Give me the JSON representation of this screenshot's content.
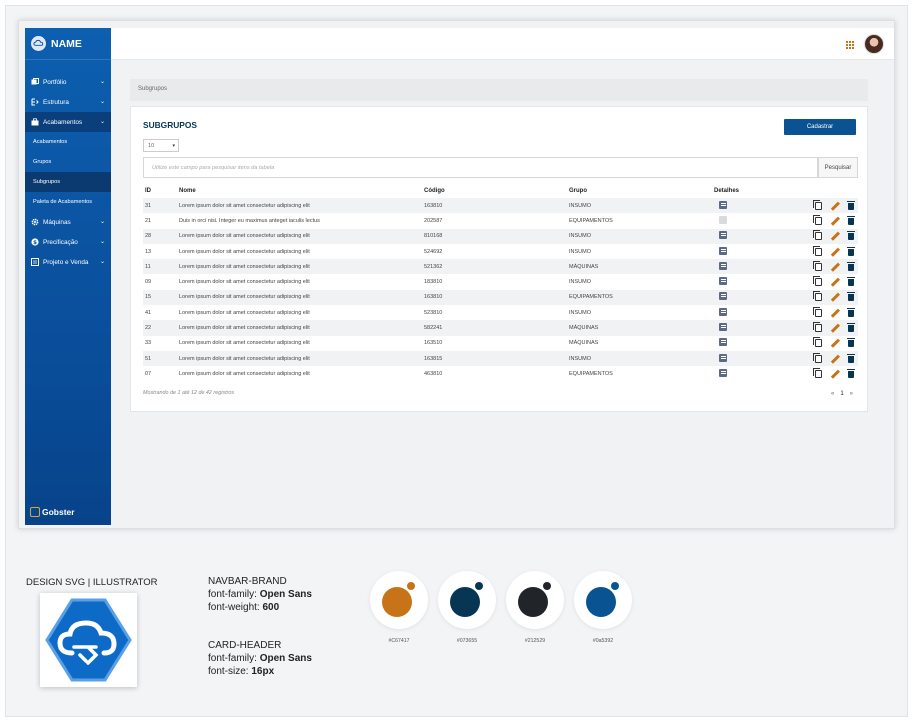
{
  "sidebar": {
    "brand": "NAME",
    "items": [
      {
        "label": "Portfólio",
        "icon": "portfolio-icon"
      },
      {
        "label": "Estrutura",
        "icon": "structure-icon"
      },
      {
        "label": "Acabamentos",
        "icon": "briefcase-icon",
        "active": true
      },
      {
        "label": "Máquinas",
        "icon": "gear-icon"
      },
      {
        "label": "Precificação",
        "icon": "dollar-icon"
      },
      {
        "label": "Projeto e Venda",
        "icon": "project-icon"
      }
    ],
    "subitems": [
      "Acabamentos",
      "Grupos",
      "Subgrupos",
      "Paleta de Acabamentos"
    ],
    "footer_brand": "Gobster"
  },
  "breadcrumb": "Subgrupos",
  "card": {
    "title": "SUBGRUPOS",
    "create_button": "Cadastrar",
    "page_size": "10",
    "search_placeholder": "Utilize este campo para pesquisar itens da tabela",
    "search_button": "Pesquisar",
    "columns": [
      "ID",
      "Nome",
      "Código",
      "Grupo",
      "Detalhes"
    ],
    "rows": [
      {
        "id": "31",
        "nome": "Lorem ipsum dolor sit amet consectetur adipiscing elit",
        "codigo": "163810",
        "grupo": "INSUMO",
        "detalhes": true
      },
      {
        "id": "21",
        "nome": "Duis in orci nisi. Integer eu maximus anteget iaculis lectus",
        "codigo": "202587",
        "grupo": "EQUIPAMENTOS",
        "detalhes": false
      },
      {
        "id": "28",
        "nome": "Lorem ipsum dolor sit amet consectetur adipiscing elit",
        "codigo": "810168",
        "grupo": "INSUMO",
        "detalhes": true
      },
      {
        "id": "13",
        "nome": "Lorem ipsum dolor sit amet consectetur adipiscing elit",
        "codigo": "524692",
        "grupo": "INSUMO",
        "detalhes": true
      },
      {
        "id": "11",
        "nome": "Lorem ipsum dolor sit amet consectetur adipiscing elit",
        "codigo": "521362",
        "grupo": "MÁQUINAS",
        "detalhes": true
      },
      {
        "id": "09",
        "nome": "Lorem ipsum dolor sit amet consectetur adipiscing elit",
        "codigo": "183810",
        "grupo": "INSUMO",
        "detalhes": true
      },
      {
        "id": "15",
        "nome": "Lorem ipsum dolor sit amet consectetur adipiscing elit",
        "codigo": "163810",
        "grupo": "EQUIPAMENTOS",
        "detalhes": true
      },
      {
        "id": "41",
        "nome": "Lorem ipsum dolor sit amet consectetur adipiscing elit",
        "codigo": "523810",
        "grupo": "INSUMO",
        "detalhes": true
      },
      {
        "id": "22",
        "nome": "Lorem ipsum dolor sit amet consectetur adipiscing elit",
        "codigo": "582241",
        "grupo": "MÁQUINAS",
        "detalhes": true
      },
      {
        "id": "33",
        "nome": "Lorem ipsum dolor sit amet consectetur adipiscing elit",
        "codigo": "163510",
        "grupo": "MÁQUINAS",
        "detalhes": true
      },
      {
        "id": "51",
        "nome": "Lorem ipsum dolor sit amet consectetur adipiscing elit",
        "codigo": "163815",
        "grupo": "INSUMO",
        "detalhes": true
      },
      {
        "id": "07",
        "nome": "Lorem ipsum dolor sit amet consectetur adipiscing elit",
        "codigo": "463810",
        "grupo": "EQUIPAMENTOS",
        "detalhes": true
      }
    ],
    "info": "Mostrando de 1 até 12 de 42 registros",
    "pager": {
      "prev": "«",
      "current": "1",
      "next": "»"
    }
  },
  "design": {
    "title": "DESIGN SVG | ILLUSTRATOR",
    "navbar_brand": {
      "heading": "NAVBAR-BRAND",
      "l1_label": "font-family:",
      "l1_value": "Open Sans",
      "l2_label": "font-weight:",
      "l2_value": "600"
    },
    "card_header": {
      "heading": "CARD-HEADER",
      "l1_label": "font-family:",
      "l1_value": "Open Sans",
      "l2_label": "font-size:",
      "l2_value": "16px"
    },
    "swatches": [
      {
        "hex": "#C67417",
        "label": "#C67417"
      },
      {
        "hex": "#073655",
        "label": "#073655"
      },
      {
        "hex": "#212529",
        "label": "#212529"
      },
      {
        "hex": "#0a5392",
        "label": "#0a5392"
      }
    ]
  }
}
